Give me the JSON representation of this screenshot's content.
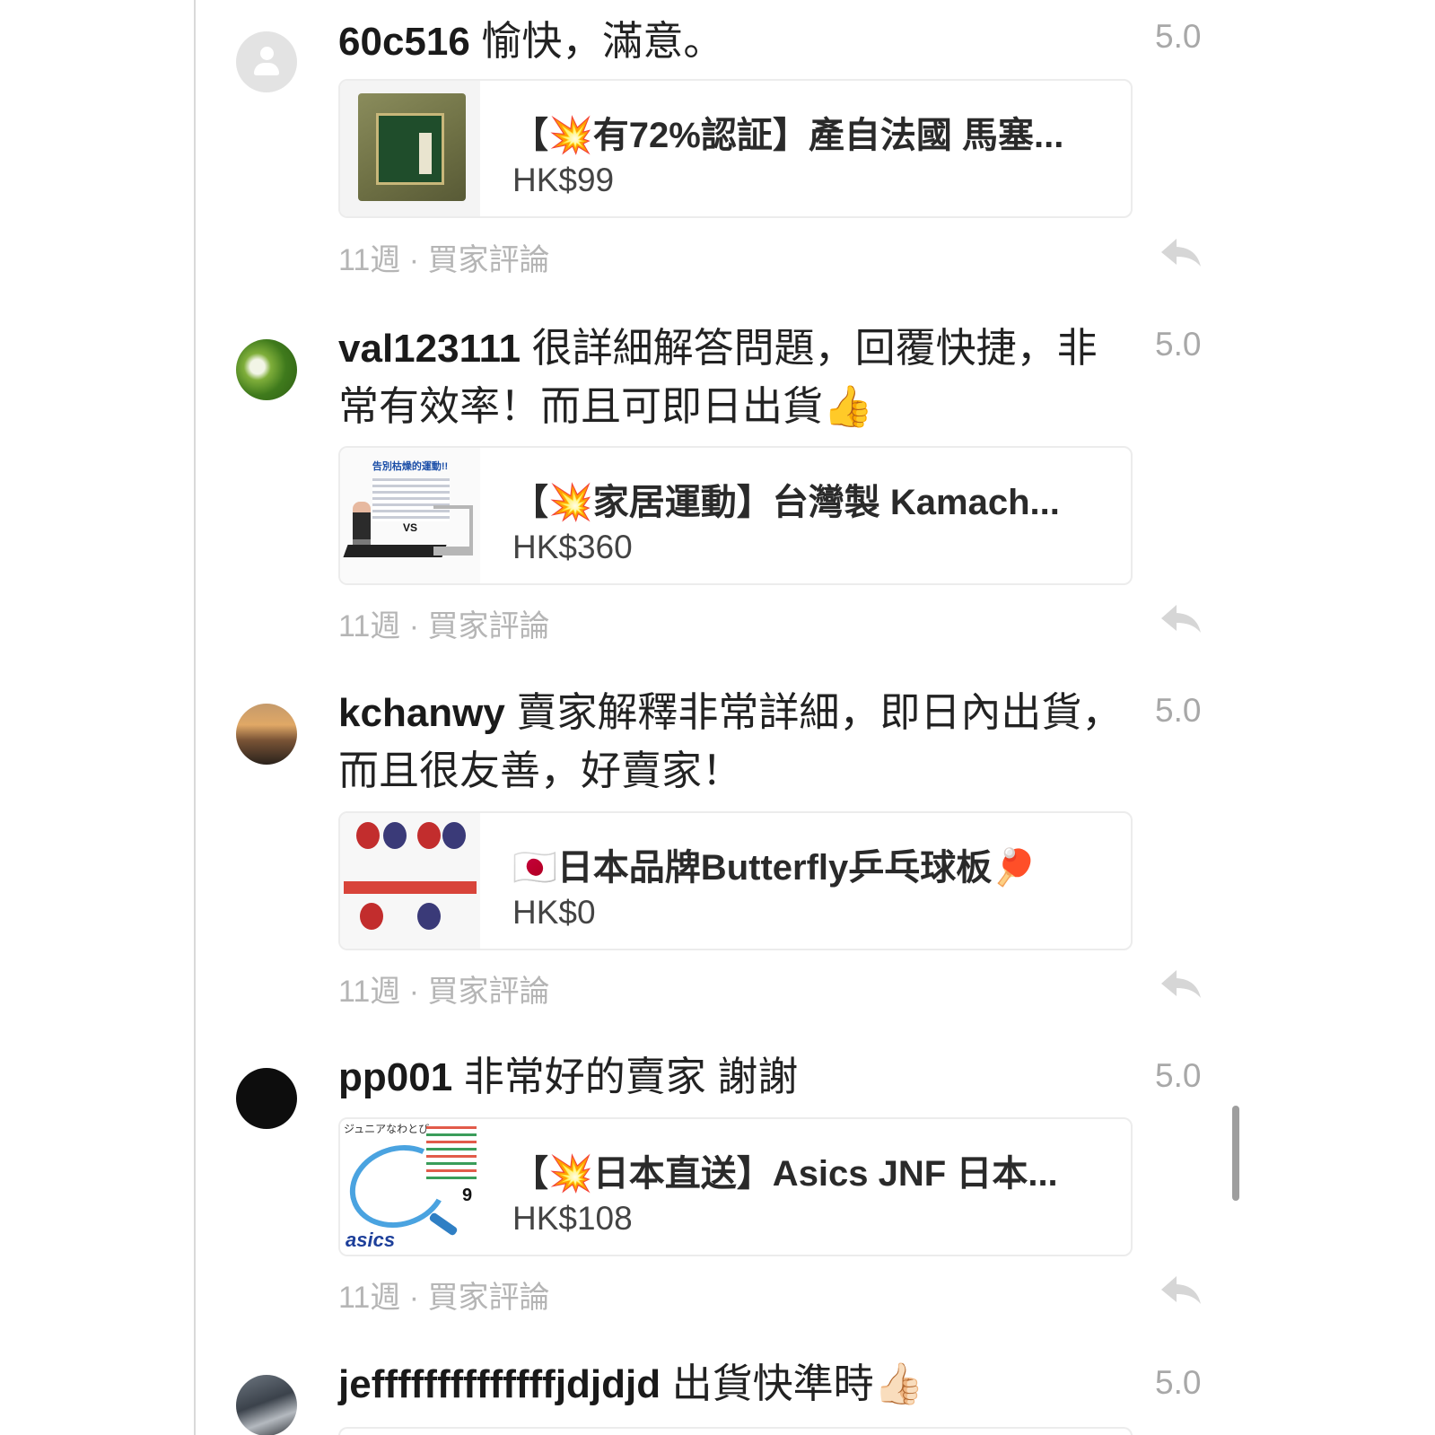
{
  "reviews": [
    {
      "username": "60c516",
      "comment": "愉快，滿意。",
      "rating": "5.0",
      "avatar": "default-avatar",
      "product": {
        "title": "【💥有72%認証】產自法國 馬塞...",
        "price": "HK$99"
      },
      "meta": "11週 · 買家評論"
    },
    {
      "username": "val123111",
      "comment": "很詳細解答問題，回覆快捷，非常有效率！而且可即日出貨👍",
      "rating": "5.0",
      "avatar": "leaf-photo-avatar",
      "product": {
        "title": "【💥家居運動】台灣製 Kamach...",
        "price": "HK$360",
        "thumb_text": "告別枯燥的運動!!",
        "thumb_vs": "VS"
      },
      "meta": "11週 · 買家評論"
    },
    {
      "username": "kchanwy",
      "comment": "賣家解釋非常詳細，即日內出貨，而且很友善，好賣家！",
      "rating": "5.0",
      "avatar": "sunset-photo-avatar",
      "product": {
        "title": "🇯🇵日本品牌Butterfly乒乓球板🏓",
        "price": "HK$0"
      },
      "meta": "11週 · 買家評論"
    },
    {
      "username": "pp001",
      "comment": "非常好的賣家 謝謝",
      "rating": "5.0",
      "avatar": "black-avatar",
      "product": {
        "title": "【💥日本直送】Asics JNF 日本...",
        "price": "HK$108",
        "thumb_text": "ジュニアなわとび",
        "thumb_brand": "asics",
        "thumb_num": "9"
      },
      "meta": "11週 · 買家評論"
    },
    {
      "username": "jeffffffffffffffjdjdjd",
      "comment": "出貨快準時👍🏻",
      "rating": "5.0",
      "avatar": "gym-photo-avatar"
    }
  ],
  "icons": {
    "reply": "reply-arrow-icon",
    "user": "user-silhouette-icon"
  },
  "colors": {
    "rating": "#a8a8a8",
    "meta": "#b5b5b5",
    "scrollbar": "#9e9e9e"
  }
}
